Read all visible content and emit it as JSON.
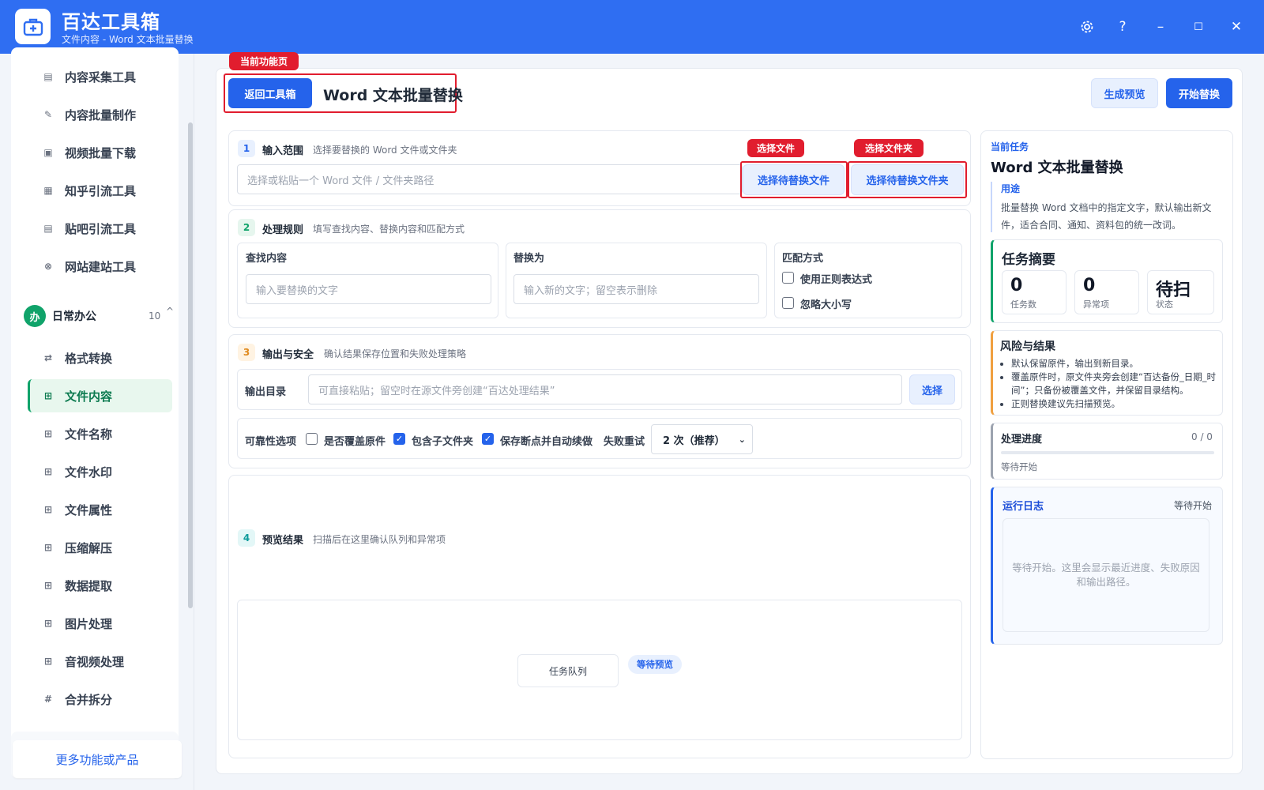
{
  "titlebar": {
    "app_title": "百达工具箱",
    "subtitle": "文件内容 - Word 文本批量替换",
    "settings_icon": "gear-icon",
    "help_label": "?",
    "minimize_label": "–",
    "maximize_label": "☐",
    "close_label": "✕"
  },
  "sidebar": {
    "top_items": [
      {
        "label": "内容采集工具",
        "icon": "document-icon"
      },
      {
        "label": "内容批量制作",
        "icon": "pen-icon"
      },
      {
        "label": "视频批量下载",
        "icon": "video-icon"
      },
      {
        "label": "知乎引流工具",
        "icon": "zhihu-icon"
      },
      {
        "label": "贴吧引流工具",
        "icon": "tieba-icon"
      },
      {
        "label": "网站建站工具",
        "icon": "web-icon"
      }
    ],
    "group": {
      "badge": "办",
      "name": "日常办公",
      "count": "10",
      "caret": "^"
    },
    "group_items": [
      {
        "label": "格式转换",
        "icon": "swap-icon"
      },
      {
        "label": "文件内容",
        "icon": "grid-icon",
        "active": true
      },
      {
        "label": "文件名称",
        "icon": "grid-icon"
      },
      {
        "label": "文件水印",
        "icon": "grid-icon"
      },
      {
        "label": "文件属性",
        "icon": "grid-icon"
      },
      {
        "label": "压缩解压",
        "icon": "grid-icon"
      },
      {
        "label": "数据提取",
        "icon": "grid-icon"
      },
      {
        "label": "图片处理",
        "icon": "grid-icon"
      },
      {
        "label": "音视频处理",
        "icon": "grid-icon"
      },
      {
        "label": "合并拆分",
        "icon": "hash-icon"
      }
    ],
    "more_link": "更多功能或产品"
  },
  "header": {
    "current_tag": "当前功能页",
    "back_button": "返回工具箱",
    "page_title": "Word 文本批量替换",
    "preview_button": "生成预览",
    "start_button": "开始替换"
  },
  "section1": {
    "step": "1",
    "title": "输入范围",
    "desc": "选择要替换的 Word 文件或文件夹",
    "path_placeholder": "选择或粘贴一个 Word 文件 / 文件夹路径",
    "tag_file": "选择文件",
    "tag_folder": "选择文件夹",
    "choose_file_button": "选择待替换文件",
    "choose_folder_button": "选择待替换文件夹"
  },
  "section2": {
    "step": "2",
    "title": "处理规则",
    "desc": "填写查找内容、替换内容和匹配方式",
    "find_label": "查找内容",
    "find_placeholder": "输入要替换的文字",
    "replace_label": "替换为",
    "replace_placeholder": "输入新的文字；留空表示删除",
    "match_label": "匹配方式",
    "regex_label": "使用正则表达式",
    "regex_checked": false,
    "ignore_case_label": "忽略大小写",
    "ignore_case_checked": false
  },
  "section3": {
    "step": "3",
    "title": "输出与安全",
    "desc": "确认结果保存位置和失败处理策略",
    "output_label": "输出目录",
    "output_placeholder": "可直接粘贴；留空时在源文件旁创建“百达处理结果”",
    "choose_button": "选择",
    "reliability_label": "可靠性选项",
    "overwrite_label": "是否覆盖原件",
    "overwrite_checked": false,
    "subfolder_label": "包含子文件夹",
    "subfolder_checked": true,
    "resume_label": "保存断点并自动续做",
    "resume_checked": true,
    "retry_label": "失败重试",
    "retry_value": "2 次（推荐）"
  },
  "section4": {
    "step": "4",
    "title": "预览结果",
    "desc": "扫描后在这里确认队列和异常项",
    "queue_label": "任务队列",
    "queue_status": "等待预览"
  },
  "right_panel": {
    "current_task_label": "当前任务",
    "task_title": "Word 文本批量替换",
    "usage_label": "用途",
    "usage_text": "批量替换 Word 文档中的指定文字，默认输出新文件，适合合同、通知、资料包的统一改词。",
    "summary_title": "任务摘要",
    "stats": [
      {
        "value": "0",
        "label": "任务数"
      },
      {
        "value": "0",
        "label": "异常项"
      },
      {
        "value": "待扫",
        "label": "状态"
      }
    ],
    "risk_title": "风险与结果",
    "risk_items": [
      "默认保留原件，输出到新目录。",
      "覆盖原件时，原文件夹旁会创建“百达备份_日期_时间”；只备份被覆盖文件，并保留目录结构。",
      "正则替换建议先扫描预览。"
    ],
    "progress_title": "处理进度",
    "progress_count": "0 / 0",
    "progress_fraction": 0,
    "progress_status": "等待开始",
    "log_title": "运行日志",
    "log_status": "等待开始",
    "log_placeholder": "等待开始。这里会显示最近进度、失败原因和输出路径。"
  },
  "colors": {
    "brand": "#2f6ef2",
    "primary": "#2563eb",
    "highlight_red": "#e11d2e",
    "active_green": "#10a36a",
    "warning_orange": "#f0a040"
  }
}
